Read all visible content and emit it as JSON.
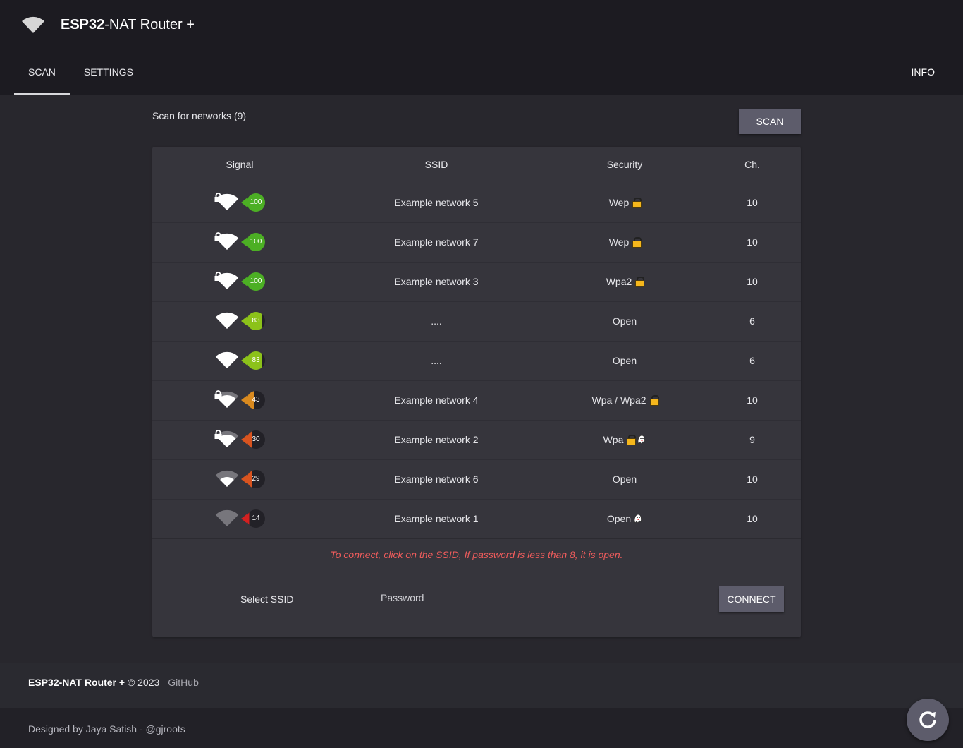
{
  "header": {
    "title_bold": "ESP32",
    "title_rest": "-NAT Router +",
    "tabs": [
      "SCAN",
      "SETTINGS"
    ],
    "info": "INFO"
  },
  "scan": {
    "label": "Scan for networks (9)",
    "button": "SCAN"
  },
  "table": {
    "columns": [
      "Signal",
      "SSID",
      "Security",
      "Ch."
    ],
    "rows": [
      {
        "quality": "100",
        "bars": 4,
        "locked": true,
        "color": "#4caf24",
        "ssid": "Example network 5",
        "security": "Wep",
        "lock": true,
        "ghost": false,
        "ch": "10"
      },
      {
        "quality": "100",
        "bars": 4,
        "locked": true,
        "color": "#4caf24",
        "ssid": "Example network 7",
        "security": "Wep",
        "lock": true,
        "ghost": false,
        "ch": "10"
      },
      {
        "quality": "100",
        "bars": 4,
        "locked": true,
        "color": "#4caf24",
        "ssid": "Example network 3",
        "security": "Wpa2",
        "lock": true,
        "ghost": false,
        "ch": "10"
      },
      {
        "quality": "83",
        "bars": 4,
        "locked": false,
        "color": "#8cc21a",
        "ssid": "....",
        "security": "Open",
        "lock": false,
        "ghost": false,
        "ch": "6"
      },
      {
        "quality": "83",
        "bars": 4,
        "locked": false,
        "color": "#8cc21a",
        "ssid": "....",
        "security": "Open",
        "lock": false,
        "ghost": false,
        "ch": "6"
      },
      {
        "quality": "43",
        "bars": 3,
        "locked": true,
        "color": "#d98a1f",
        "ssid": "Example network 4",
        "security": "Wpa / Wpa2",
        "lock": true,
        "ghost": false,
        "ch": "10"
      },
      {
        "quality": "30",
        "bars": 3,
        "locked": true,
        "color": "#d9541f",
        "ssid": "Example network 2",
        "security": "Wpa",
        "lock": true,
        "ghost": true,
        "ch": "9"
      },
      {
        "quality": "29",
        "bars": 2,
        "locked": false,
        "color": "#d9541f",
        "ssid": "Example network 6",
        "security": "Open",
        "lock": false,
        "ghost": false,
        "ch": "10"
      },
      {
        "quality": "14",
        "bars": 0,
        "locked": false,
        "color": "#d42020",
        "ssid": "Example network 1",
        "security": "Open",
        "lock": false,
        "ghost": true,
        "ch": "10"
      }
    ]
  },
  "connect": {
    "hint": "To connect, click on the SSID, If password is less than 8, it is open.",
    "select_label": "Select SSID",
    "password_placeholder": "Password",
    "button": "CONNECT"
  },
  "footer": {
    "brand": "ESP32-NAT Router +",
    "copyright": "© 2023",
    "link": "GitHub",
    "credit": "Designed by Jaya Satish - @gjroots"
  }
}
